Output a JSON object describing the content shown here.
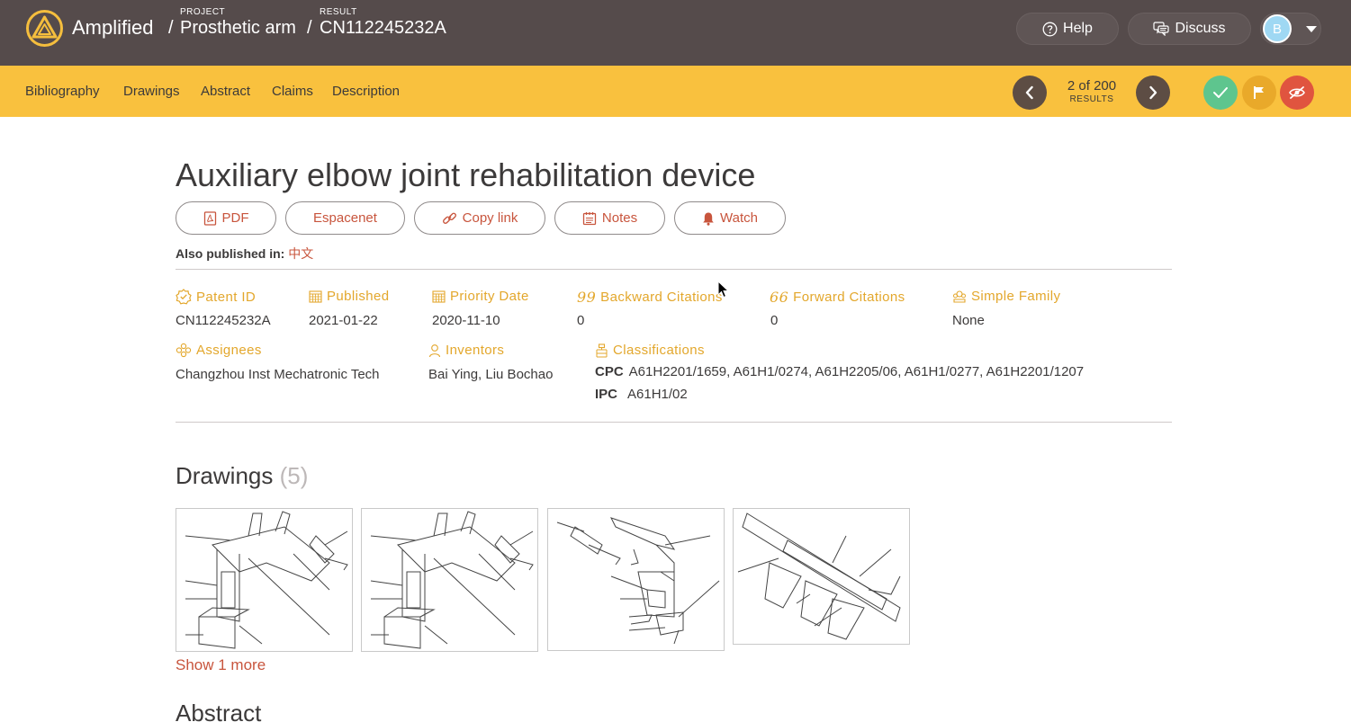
{
  "header": {
    "brand": "Amplified",
    "project_caption": "PROJECT",
    "project_name": "Prosthetic arm",
    "result_caption": "RESULT",
    "result_id": "CN112245232A",
    "separator": "/",
    "help_label": "Help",
    "discuss_label": "Discuss",
    "avatar_initial": "B"
  },
  "tabs": [
    "Bibliography",
    "Drawings",
    "Abstract",
    "Claims",
    "Description"
  ],
  "pager": {
    "count": "2 of 200",
    "caption": "RESULTS"
  },
  "document": {
    "title": "Auxiliary elbow joint rehabilitation device",
    "buttons": {
      "pdf": "PDF",
      "espacenet": "Espacenet",
      "copy_link": "Copy link",
      "notes": "Notes",
      "watch": "Watch"
    },
    "also_published_label": "Also published in:",
    "also_published_value": "中文"
  },
  "fields": {
    "patent_id": {
      "label": "Patent ID",
      "value": "CN112245232A"
    },
    "published": {
      "label": "Published",
      "value": "2021-01-22"
    },
    "priority_date": {
      "label": "Priority Date",
      "value": "2020-11-10"
    },
    "backward_citations": {
      "label": "Backward Citations",
      "value": "0"
    },
    "forward_citations": {
      "label": "Forward Citations",
      "value": "0"
    },
    "simple_family": {
      "label": "Simple Family",
      "value": "None"
    },
    "assignees": {
      "label": "Assignees",
      "value": "Changzhou Inst Mechatronic Tech"
    },
    "inventors": {
      "label": "Inventors",
      "value": "Bai Ying, Liu Bochao"
    },
    "classifications": {
      "label": "Classifications",
      "cpc_label": "CPC",
      "cpc_value": "A61H2201/1659, A61H1/0274, A61H2205/06, A61H1/0277, A61H2201/1207",
      "ipc_label": "IPC",
      "ipc_value": "A61H1/02"
    }
  },
  "drawings": {
    "heading": "Drawings",
    "count": "(5)",
    "show_more": "Show 1 more"
  },
  "abstract": {
    "heading": "Abstract"
  },
  "colors": {
    "topbar": "#554b4b",
    "tabbar": "#f9c13e",
    "accent_red": "#c8553d",
    "label_gold": "#e3a72c",
    "approve": "#5ec58e",
    "flag": "#e9a92a",
    "hide": "#e0543f"
  }
}
